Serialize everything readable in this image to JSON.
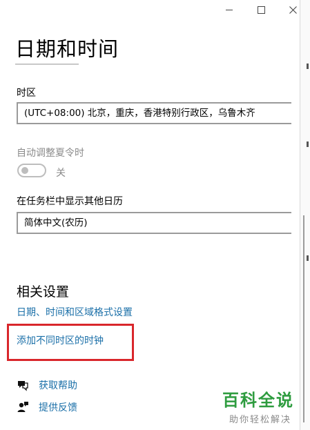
{
  "window": {
    "controls": {
      "minimize": "minimize",
      "maximize": "maximize",
      "close": "close"
    }
  },
  "page": {
    "title": "日期和时间"
  },
  "timezone": {
    "label": "时区",
    "value": "(UTC+08:00) 北京，重庆，香港特别行政区，乌鲁木齐"
  },
  "dst": {
    "label": "自动调整夏令时",
    "toggle_state": "关",
    "enabled": false
  },
  "calendar": {
    "label": "在任务栏中显示其他日历",
    "value": "简体中文(农历)"
  },
  "related": {
    "title": "相关设置",
    "links": [
      {
        "label": "日期、时间和区域格式设置"
      },
      {
        "label": "添加不同时区的时钟"
      }
    ]
  },
  "help": {
    "get_help": "获取帮助",
    "feedback": "提供反馈"
  },
  "watermark": {
    "main": "百科全说",
    "sub": "助你轻松解决"
  },
  "colors": {
    "link": "#1a6fa8",
    "highlight": "#d9262b",
    "watermark_green": "#2e9c3f"
  }
}
